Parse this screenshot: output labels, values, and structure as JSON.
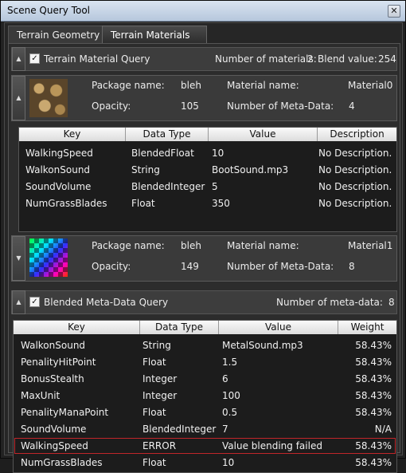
{
  "window": {
    "title": "Scene Query Tool",
    "close_glyph": "✕"
  },
  "tabs": [
    {
      "label": "Terrain Geometry"
    },
    {
      "label": "Terrain Materials"
    }
  ],
  "terrain_query": {
    "label": "Terrain Material Query",
    "checked": true,
    "count_label": "Number of materials:",
    "count_value": "2",
    "blend_label": "Blend value:",
    "blend_value": "254"
  },
  "materials": [
    {
      "package_label": "Package name:",
      "package": "bleh",
      "material_label": "Material name:",
      "material": "Material0",
      "opacity_label": "Opacity:",
      "opacity": "105",
      "meta_label": "Number of Meta-Data:",
      "meta_count": "4",
      "expander": "▲",
      "thumb": "cobblestone-texture"
    },
    {
      "package_label": "Package name:",
      "package": "bleh",
      "material_label": "Material name:",
      "material": "Material1",
      "opacity_label": "Opacity:",
      "opacity": "149",
      "meta_label": "Number of Meta-Data:",
      "meta_count": "8",
      "expander": "▼",
      "thumb": "rainbow-checker-texture"
    }
  ],
  "material_table": {
    "headers": [
      "Key",
      "Data Type",
      "Value",
      "Description"
    ],
    "rows": [
      [
        "WalkingSpeed",
        "BlendedFloat",
        "10",
        "No Description."
      ],
      [
        "WalkonSound",
        "String",
        "BootSound.mp3",
        "No Description."
      ],
      [
        "SoundVolume",
        "BlendedInteger",
        "5",
        "No Description."
      ],
      [
        "NumGrassBlades",
        "Float",
        "350",
        "No Description."
      ]
    ]
  },
  "blended_query": {
    "label": "Blended Meta-Data Query",
    "checked": true,
    "count_label": "Number of meta-data:",
    "count_value": "8"
  },
  "blended_table": {
    "headers": [
      "Key",
      "Data Type",
      "Value",
      "Weight"
    ],
    "rows": [
      [
        "WalkonSound",
        "String",
        "MetalSound.mp3",
        "58.43%"
      ],
      [
        "PenalityHitPoint",
        "Float",
        "1.5",
        "58.43%"
      ],
      [
        "BonusStealth",
        "Integer",
        "6",
        "58.43%"
      ],
      [
        "MaxUnit",
        "Integer",
        "100",
        "58.43%"
      ],
      [
        "PenalityManaPoint",
        "Float",
        "0.5",
        "58.43%"
      ],
      [
        "SoundVolume",
        "BlendedInteger",
        "7",
        "N/A"
      ],
      [
        "WalkingSpeed",
        "ERROR",
        "Value blending failed",
        "58.43%"
      ],
      [
        "NumGrassBlades",
        "Float",
        "10",
        "58.43%"
      ]
    ],
    "selected_index": 6
  },
  "colors": {
    "accent_error": "#c0262a",
    "panel": "#3a3a3a",
    "table_bg": "#1c1c1c"
  }
}
